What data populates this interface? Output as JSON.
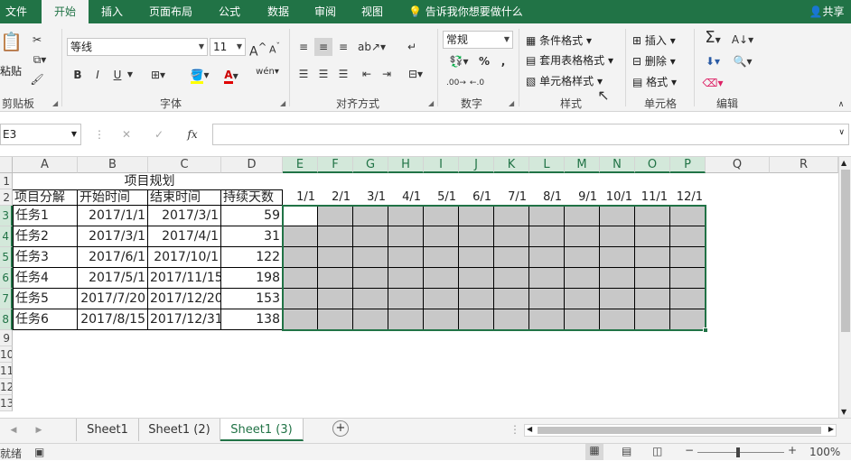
{
  "ribbon_tabs": {
    "file": "文件",
    "home": "开始",
    "insert": "插入",
    "layout": "页面布局",
    "formula": "公式",
    "data": "数据",
    "review": "审阅",
    "view": "视图",
    "tell": "告诉我你想要做什么",
    "share": "共享"
  },
  "clipboard": {
    "paste": "粘贴",
    "group": "剪贴板"
  },
  "font": {
    "name": "等线",
    "size": "11",
    "grow": "A",
    "shrink": "A",
    "bold": "B",
    "italic": "I",
    "underline": "U",
    "color_letter": "A",
    "wen": "wén",
    "group": "字体"
  },
  "alignment": {
    "group": "对齐方式"
  },
  "number": {
    "format": "常规",
    "percent": "%",
    "comma": ",",
    "group": "数字"
  },
  "styles": {
    "conditional": "条件格式",
    "table": "套用表格格式",
    "cell": "单元格样式",
    "group": "样式"
  },
  "cells": {
    "insert": "插入",
    "delete": "删除",
    "format": "格式",
    "group": "单元格"
  },
  "editing": {
    "group": "编辑"
  },
  "formula_bar": {
    "namebox": "E3",
    "cancel": "✕",
    "enter": "✓",
    "fx": "fx",
    "content": ""
  },
  "columns": [
    "A",
    "B",
    "C",
    "D",
    "E",
    "F",
    "G",
    "H",
    "I",
    "J",
    "K",
    "L",
    "M",
    "N",
    "O",
    "P",
    "Q",
    "R"
  ],
  "rows": [
    "1",
    "2",
    "3",
    "4",
    "5",
    "6",
    "7",
    "8",
    "9",
    "10",
    "11",
    "12",
    "13"
  ],
  "title": "项目规划",
  "headers": [
    "项目分解",
    "开始时间",
    "结束时间",
    "持续天数"
  ],
  "months": [
    "1/1",
    "2/1",
    "3/1",
    "4/1",
    "5/1",
    "6/1",
    "7/1",
    "8/1",
    "9/1",
    "10/1",
    "11/1",
    "12/1"
  ],
  "tasks": [
    {
      "name": "任务1",
      "start": "2017/1/1",
      "end": "2017/3/1",
      "days": "59"
    },
    {
      "name": "任务2",
      "start": "2017/3/1",
      "end": "2017/4/1",
      "days": "31"
    },
    {
      "name": "任务3",
      "start": "2017/6/1",
      "end": "2017/10/1",
      "days": "122"
    },
    {
      "name": "任务4",
      "start": "2017/5/1",
      "end": "2017/11/15",
      "days": "198"
    },
    {
      "name": "任务5",
      "start": "2017/7/20",
      "end": "2017/12/20",
      "days": "153"
    },
    {
      "name": "任务6",
      "start": "2017/8/15",
      "end": "2017/12/31",
      "days": "138"
    }
  ],
  "sheets": [
    "Sheet1",
    "Sheet1 (2)",
    "Sheet1 (3)"
  ],
  "status": {
    "ready": "就绪",
    "zoom": "100%"
  }
}
